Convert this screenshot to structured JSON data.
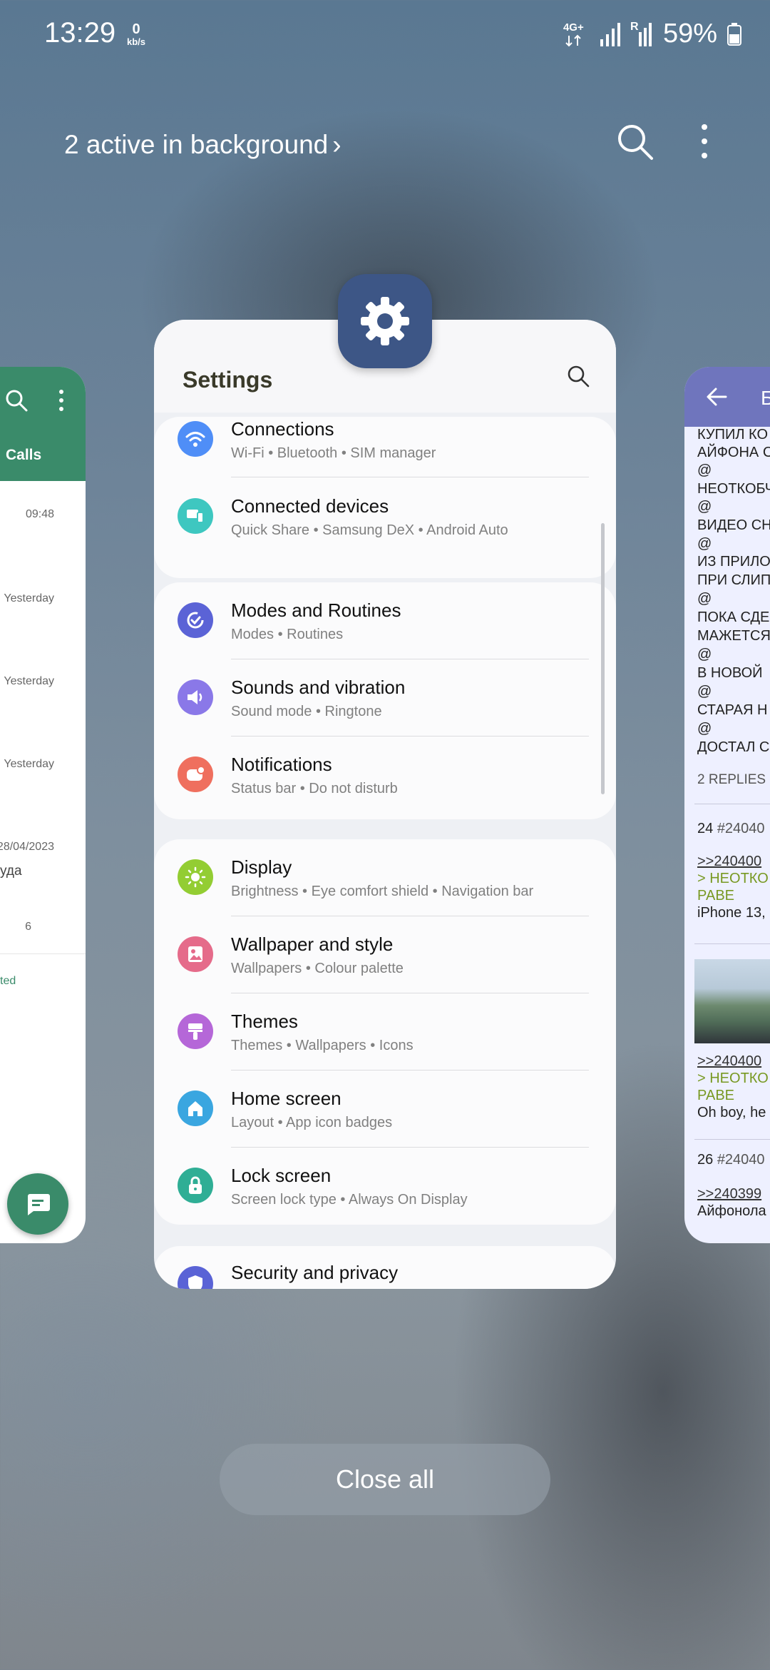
{
  "status": {
    "time": "13:29",
    "net_speed_value": "0",
    "net_speed_unit": "kb/s",
    "network": "4G+",
    "roaming": "R",
    "battery": "59%"
  },
  "recents": {
    "background_label": "2 active in background",
    "chevron": "›",
    "close_all": "Close all"
  },
  "settings_card": {
    "title": "Settings",
    "groups": [
      {
        "items": [
          {
            "title": "Connections",
            "subtitle": "Wi-Fi  •  Bluetooth  •  SIM manager",
            "icon": "wifi-icon",
            "color": "#4f8ef7"
          },
          {
            "title": "Connected devices",
            "subtitle": "Quick Share  •  Samsung DeX  •  Android Auto",
            "icon": "connected-devices-icon",
            "color": "#3ec7c0"
          }
        ]
      },
      {
        "items": [
          {
            "title": "Modes and Routines",
            "subtitle": "Modes  •  Routines",
            "icon": "modes-routines-icon",
            "color": "#5b63d6"
          },
          {
            "title": "Sounds and vibration",
            "subtitle": "Sound mode  •  Ringtone",
            "icon": "speaker-icon",
            "color": "#8a78e8"
          },
          {
            "title": "Notifications",
            "subtitle": "Status bar  •  Do not disturb",
            "icon": "notifications-icon",
            "color": "#ef6f5e"
          }
        ]
      },
      {
        "items": [
          {
            "title": "Display",
            "subtitle": "Brightness  •  Eye comfort shield  •  Navigation bar",
            "icon": "sun-icon",
            "color": "#93cd33"
          },
          {
            "title": "Wallpaper and style",
            "subtitle": "Wallpapers  •  Colour palette",
            "icon": "wallpaper-icon",
            "color": "#e56b8a"
          },
          {
            "title": "Themes",
            "subtitle": "Themes  •  Wallpapers  •  Icons",
            "icon": "themes-icon",
            "color": "#b567d8"
          },
          {
            "title": "Home screen",
            "subtitle": "Layout  •  App icon badges",
            "icon": "home-icon",
            "color": "#3aa6e0"
          },
          {
            "title": "Lock screen",
            "subtitle": "Screen lock type  •  Always On Display",
            "icon": "lock-icon",
            "color": "#2fae95"
          }
        ]
      },
      {
        "items": [
          {
            "title": "Security and privacy",
            "subtitle": "",
            "icon": "shield-icon",
            "color": "#5a63d6"
          }
        ]
      }
    ]
  },
  "left_card": {
    "tab_label": "Calls",
    "times": [
      "09:48",
      "Yesterday",
      "Yesterday",
      "Yesterday",
      "28/04/2023"
    ],
    "fragment": "уда",
    "count": "6",
    "footer": "ted",
    "accent": "#3a8b6a"
  },
  "right_card": {
    "header_letter": "Б",
    "lines": [
      "КУПИЛ КО",
      "АЙФОНА С",
      "@",
      "НЕОТКОБЧ",
      "@",
      "ВИДЕО СН",
      "@",
      "ИЗ ПРИЛО",
      "ПРИ СЛИП",
      "@",
      "ПОКА СДЕ",
      "МАЖЕТСЯ",
      "@",
      "В НОВОЙ",
      "@",
      "СТАРАЯ Н",
      "@",
      "ДОСТАЛ С"
    ],
    "replies": "2 REPLIES",
    "post1": {
      "num": "24",
      "id": "#24040",
      "link": ">>240400",
      "quote": "> НЕОТКО",
      "quote2": "РАВЕ",
      "text": "iPhone 13,"
    },
    "post2": {
      "link": ">>240400",
      "quote": "> НЕОТКО",
      "quote2": "РАВЕ",
      "text": "Oh boy, he"
    },
    "post3": {
      "num": "26",
      "id": "#24040",
      "link": ">>240399",
      "text": "Айфонола"
    },
    "accent": "#6f75bd"
  }
}
